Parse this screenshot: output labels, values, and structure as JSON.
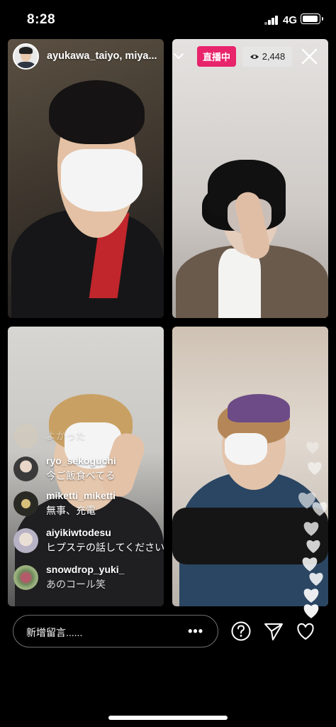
{
  "status_bar": {
    "time": "8:28",
    "network": "4G"
  },
  "header": {
    "host_names": "ayukawa_taiyo, miya...",
    "live_label": "直播中",
    "viewer_count": "2,448"
  },
  "comments": [
    {
      "user": "",
      "message": "よかった"
    },
    {
      "user": "ryo_sekoguchi",
      "message": "今ご飯食べてる"
    },
    {
      "user": "miketti_miketti",
      "message": "無事、充電"
    },
    {
      "user": "aiyikiwtodesu",
      "message": "ヒプステの話してください"
    },
    {
      "user": "snowdrop_yuki_",
      "message": "あのコール笑"
    }
  ],
  "comment_input": {
    "placeholder": "新增留言......",
    "more": "•••"
  },
  "icons": {
    "question": "question-icon",
    "send": "send-icon",
    "heart": "heart-icon",
    "close": "close-icon",
    "eye": "eye-icon",
    "chevron": "chevron-down-icon"
  },
  "colors": {
    "live_badge": "#e8246b",
    "background": "#000000"
  }
}
